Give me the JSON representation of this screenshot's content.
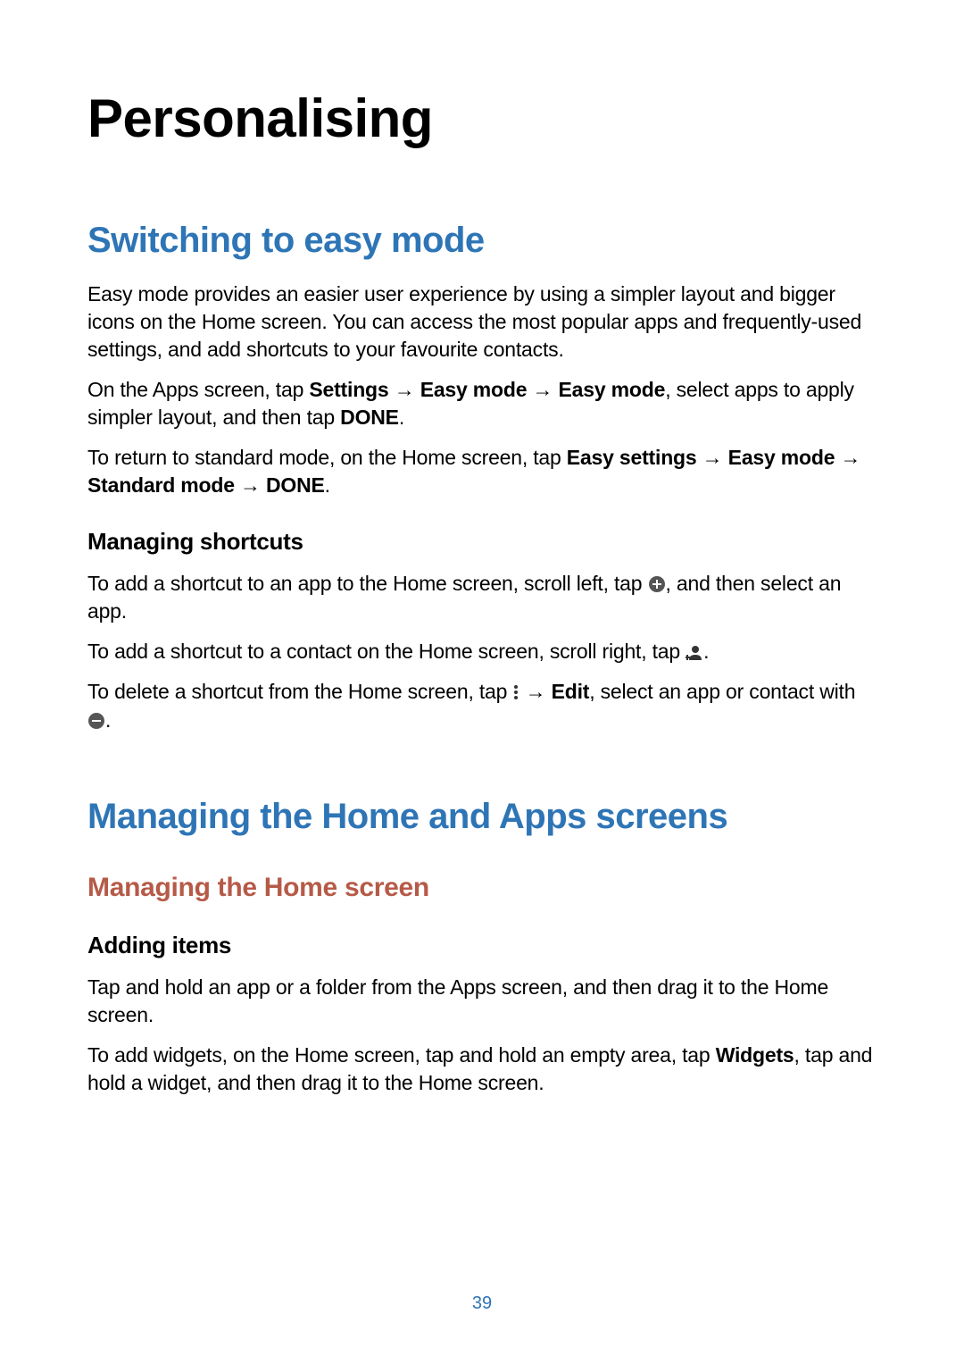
{
  "chapter_title": "Personalising",
  "section1": {
    "title": "Switching to easy mode",
    "para1": "Easy mode provides an easier user experience by using a simpler layout and bigger icons on the Home screen. You can access the most popular apps and frequently-used settings, and add shortcuts to your favourite contacts.",
    "para2_pre": "On the Apps screen, tap ",
    "para2_b1": "Settings",
    "para2_arrow": " → ",
    "para2_b2": "Easy mode",
    "para2_b3": "Easy mode",
    "para2_mid": ", select apps to apply simpler layout, and then tap ",
    "para2_b4": "DONE",
    "para2_end": ".",
    "para3_pre": "To return to standard mode, on the Home screen, tap ",
    "para3_b1": "Easy settings",
    "para3_b2": "Easy mode",
    "para3_b3": "Standard mode",
    "para3_b4": "DONE",
    "para3_end": ".",
    "sub1": {
      "title": "Managing shortcuts",
      "p1_pre": "To add a shortcut to an app to the Home screen, scroll left, tap ",
      "p1_post": ", and then select an app.",
      "p2_pre": "To add a shortcut to a contact on the Home screen, scroll right, tap ",
      "p2_post": ".",
      "p3_pre": "To delete a shortcut from the Home screen, tap ",
      "p3_mid1": " → ",
      "p3_b1": "Edit",
      "p3_mid2": ", select an app or contact with ",
      "p3_post": "."
    }
  },
  "section2": {
    "title": "Managing the Home and Apps screens",
    "sub1": {
      "title": "Managing the Home screen",
      "minor1": {
        "title": "Adding items",
        "p1": "Tap and hold an app or a folder from the Apps screen, and then drag it to the Home screen.",
        "p2_pre": "To add widgets, on the Home screen, tap and hold an empty area, tap ",
        "p2_b1": "Widgets",
        "p2_post": ", tap and hold a widget, and then drag it to the Home screen."
      }
    }
  },
  "page_number": "39",
  "icons": {
    "plus": "plus-circle-icon",
    "contact": "add-contact-icon",
    "menu": "more-dots-icon",
    "minus": "minus-circle-icon"
  }
}
